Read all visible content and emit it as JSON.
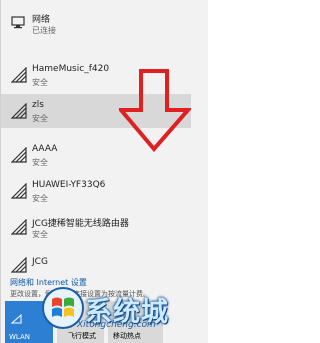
{
  "current": {
    "name": "网络",
    "status": "已连接"
  },
  "networks": [
    {
      "name": "HameMusic_f420",
      "status": "安全"
    },
    {
      "name": "zls",
      "status": "安全"
    },
    {
      "name": "AAAA",
      "status": "安全"
    },
    {
      "name": "HUAWEI-YF33Q6",
      "status": "安全"
    },
    {
      "name": "JCG捷稀智能无线路由器",
      "status": "安全"
    },
    {
      "name": "JCG",
      "status": ""
    }
  ],
  "settings": {
    "link": "网络和 Internet 设置",
    "sub": "更改设置，例如将某连接设置为按流量计费。"
  },
  "quick_actions": [
    {
      "label": "WLAN",
      "active": true
    },
    {
      "label": "飞行模式",
      "active": false
    },
    {
      "label": "移动热点",
      "active": false
    }
  ],
  "watermark": {
    "text": "系统城",
    "url": "Xitongcheng.com"
  },
  "colors": {
    "accent": "#2d7fd3",
    "arrow": "#e02020",
    "selected": "#d8d8d8"
  }
}
